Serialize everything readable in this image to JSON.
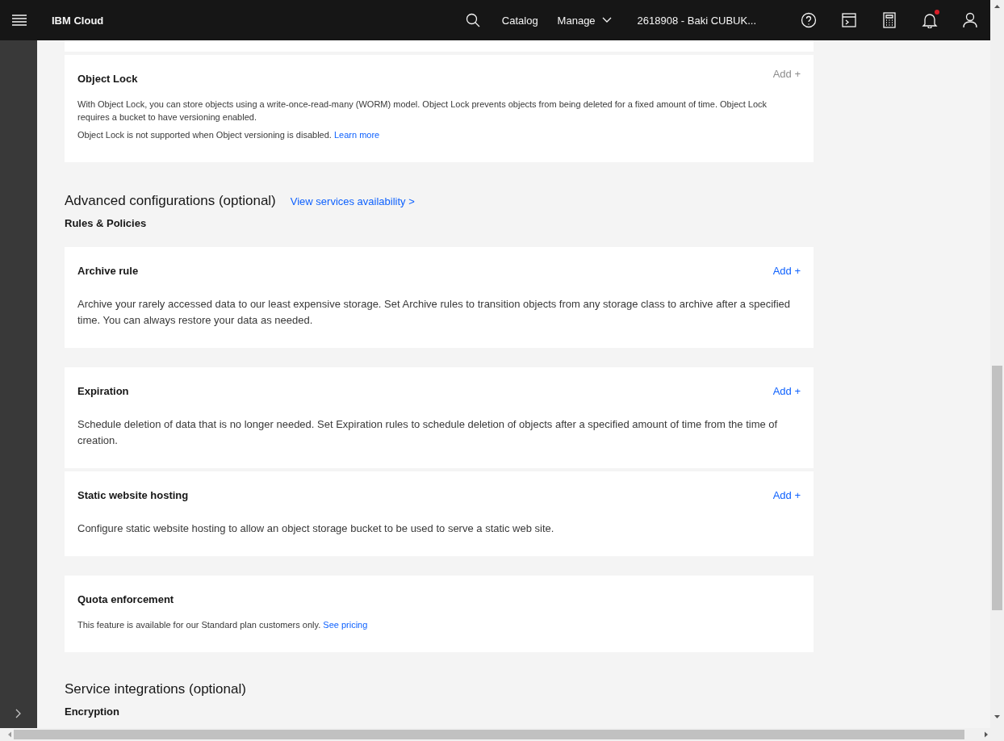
{
  "header": {
    "brand": "IBM Cloud",
    "nav": [
      {
        "label": "Catalog",
        "dropdown": false
      },
      {
        "label": "Manage",
        "dropdown": true
      }
    ],
    "account": "2618908 - Baki CUBUK...",
    "notification_unread": true
  },
  "top_cards": [
    {
      "kind": "compact",
      "title": "Object Lock",
      "add": "Add +",
      "disabled": true,
      "paragraphs": [
        {
          "text": "With Object Lock, you can store objects using a write-once-read-many (WORM) model. Object Lock prevents objects from being deleted for a fixed amount of time. Object Lock requires a bucket to have versioning enabled."
        },
        {
          "text": "Object Lock is not supported when Object versioning is disabled.",
          "link": "Learn more"
        }
      ]
    }
  ],
  "advanced": {
    "heading": "Advanced configurations (optional)",
    "link": "View services availability >",
    "subheading": "Rules & Policies"
  },
  "rule_cards": [
    {
      "kind": "standard",
      "title": "Archive rule",
      "add": "Add +",
      "disabled": false,
      "paragraphs": [
        {
          "text": "Archive your rarely accessed data to our least expensive storage. Set Archive rules to transition objects from any storage class to archive after a specified time. You can always restore your data as needed."
        }
      ]
    },
    {
      "kind": "standard",
      "title": "Expiration",
      "add": "Add +",
      "disabled": false,
      "paragraphs": [
        {
          "text": "Schedule deletion of data that is no longer needed. Set Expiration rules to schedule deletion of objects after a specified amount of time from the time of creation."
        }
      ]
    },
    {
      "kind": "standard",
      "title": "Static website hosting",
      "add": "Add +",
      "disabled": false,
      "paragraphs": [
        {
          "text": "Configure static website hosting to allow an object storage bucket to be used to serve a static web site."
        }
      ]
    },
    {
      "kind": "compact",
      "title": "Quota enforcement",
      "paragraphs": [
        {
          "text": "This feature is available for our Standard plan customers only.",
          "link": "See pricing"
        }
      ]
    }
  ],
  "integrations": {
    "heading": "Service integrations (optional)",
    "subheading": "Encryption"
  }
}
